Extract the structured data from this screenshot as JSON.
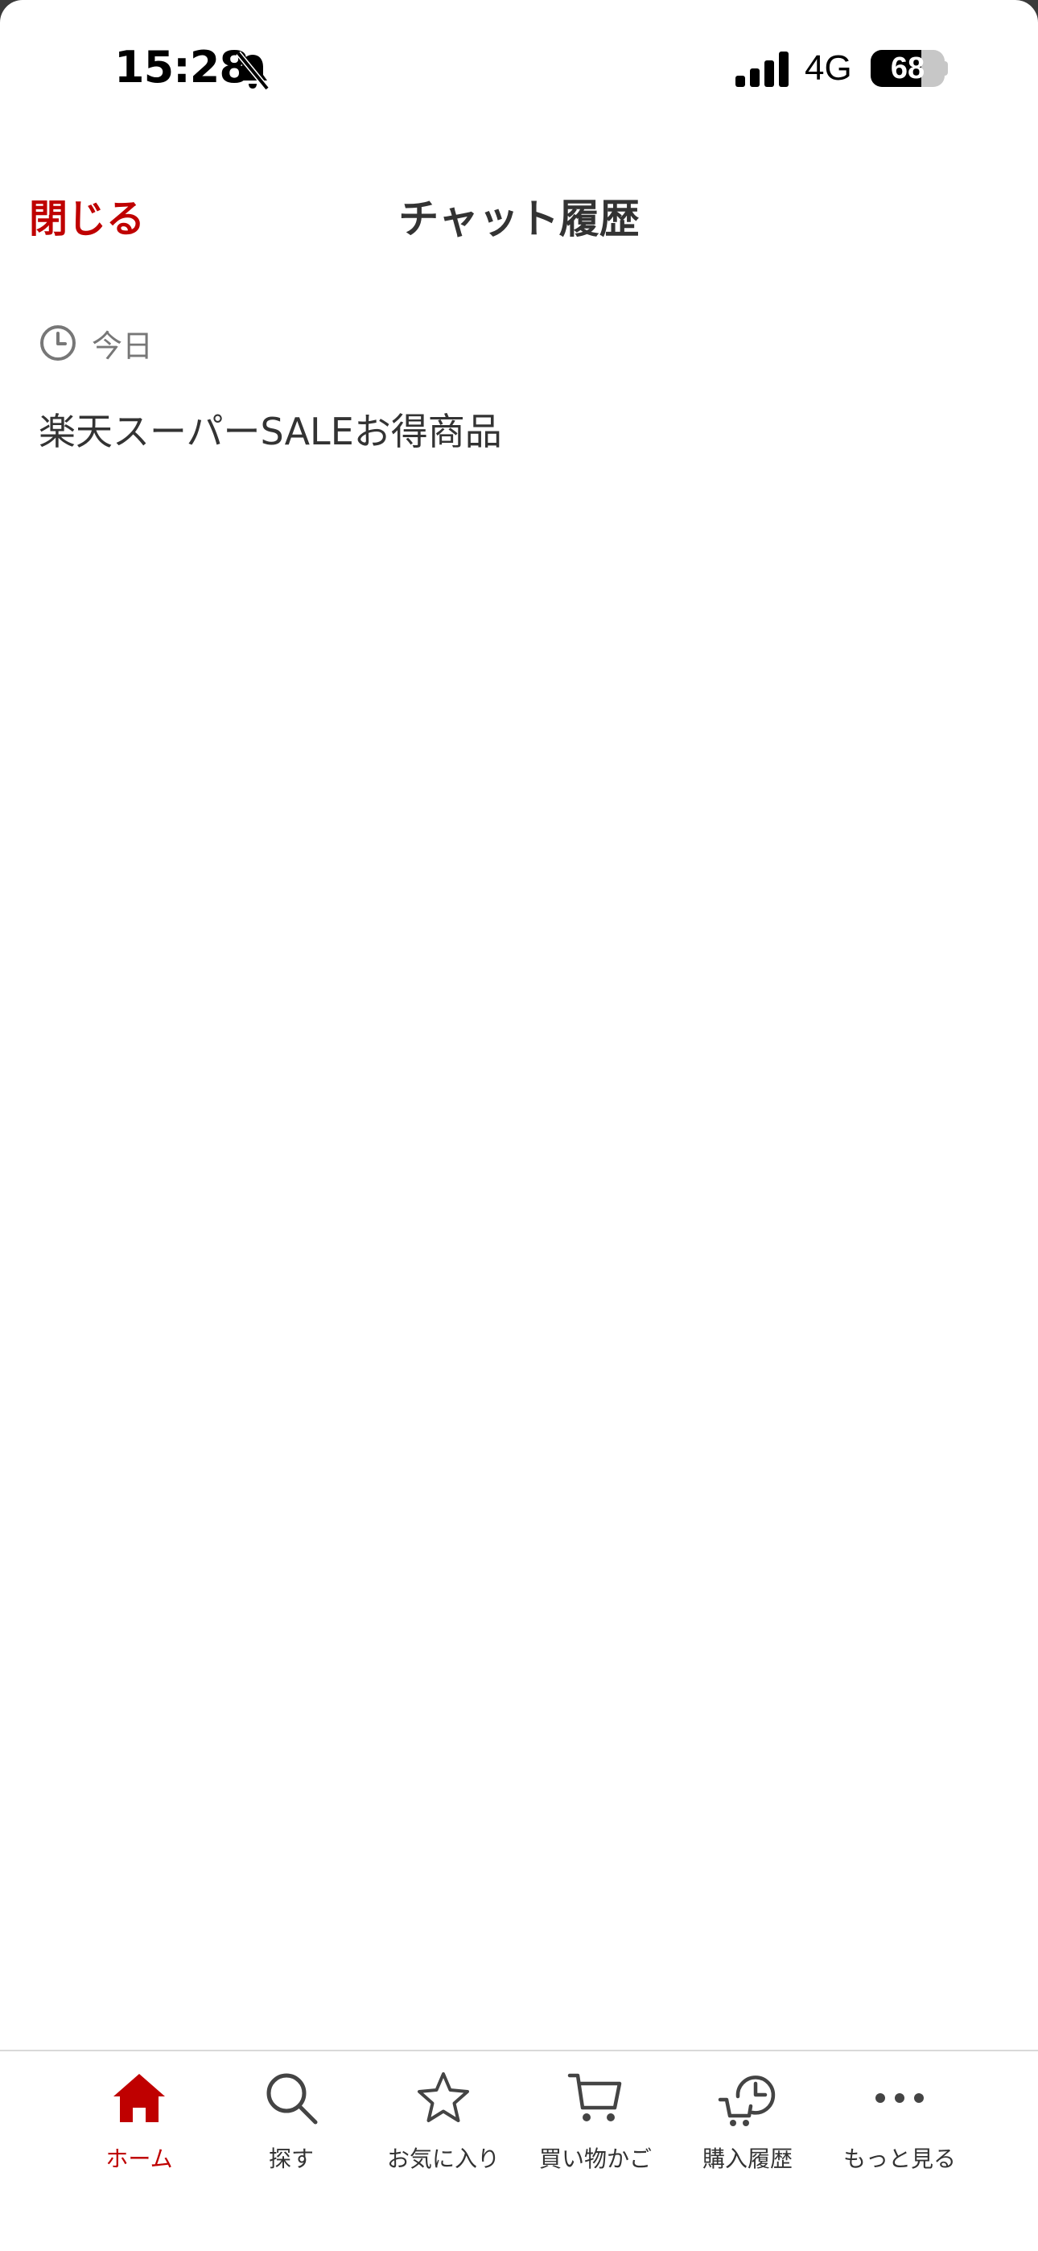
{
  "status_bar": {
    "time": "15:28",
    "network": "4G",
    "battery": "68",
    "battery_level": 0.68
  },
  "header": {
    "close_label": "閉じる",
    "title": "チャット履歴"
  },
  "history": {
    "section_label": "今日",
    "items": [
      "楽天スーパーSALEお得商品"
    ]
  },
  "tab_bar": {
    "tabs": [
      {
        "label": "ホーム",
        "icon": "home-icon",
        "active": true
      },
      {
        "label": "探す",
        "icon": "search-icon",
        "active": false
      },
      {
        "label": "お気に入り",
        "icon": "star-icon",
        "active": false
      },
      {
        "label": "買い物かご",
        "icon": "cart-icon",
        "active": false
      },
      {
        "label": "購入履歴",
        "icon": "purchase-history-icon",
        "active": false
      },
      {
        "label": "もっと見る",
        "icon": "more-icon",
        "active": false
      }
    ]
  },
  "colors": {
    "accent": "#bf0000",
    "text": "#333333",
    "muted": "#777777"
  }
}
